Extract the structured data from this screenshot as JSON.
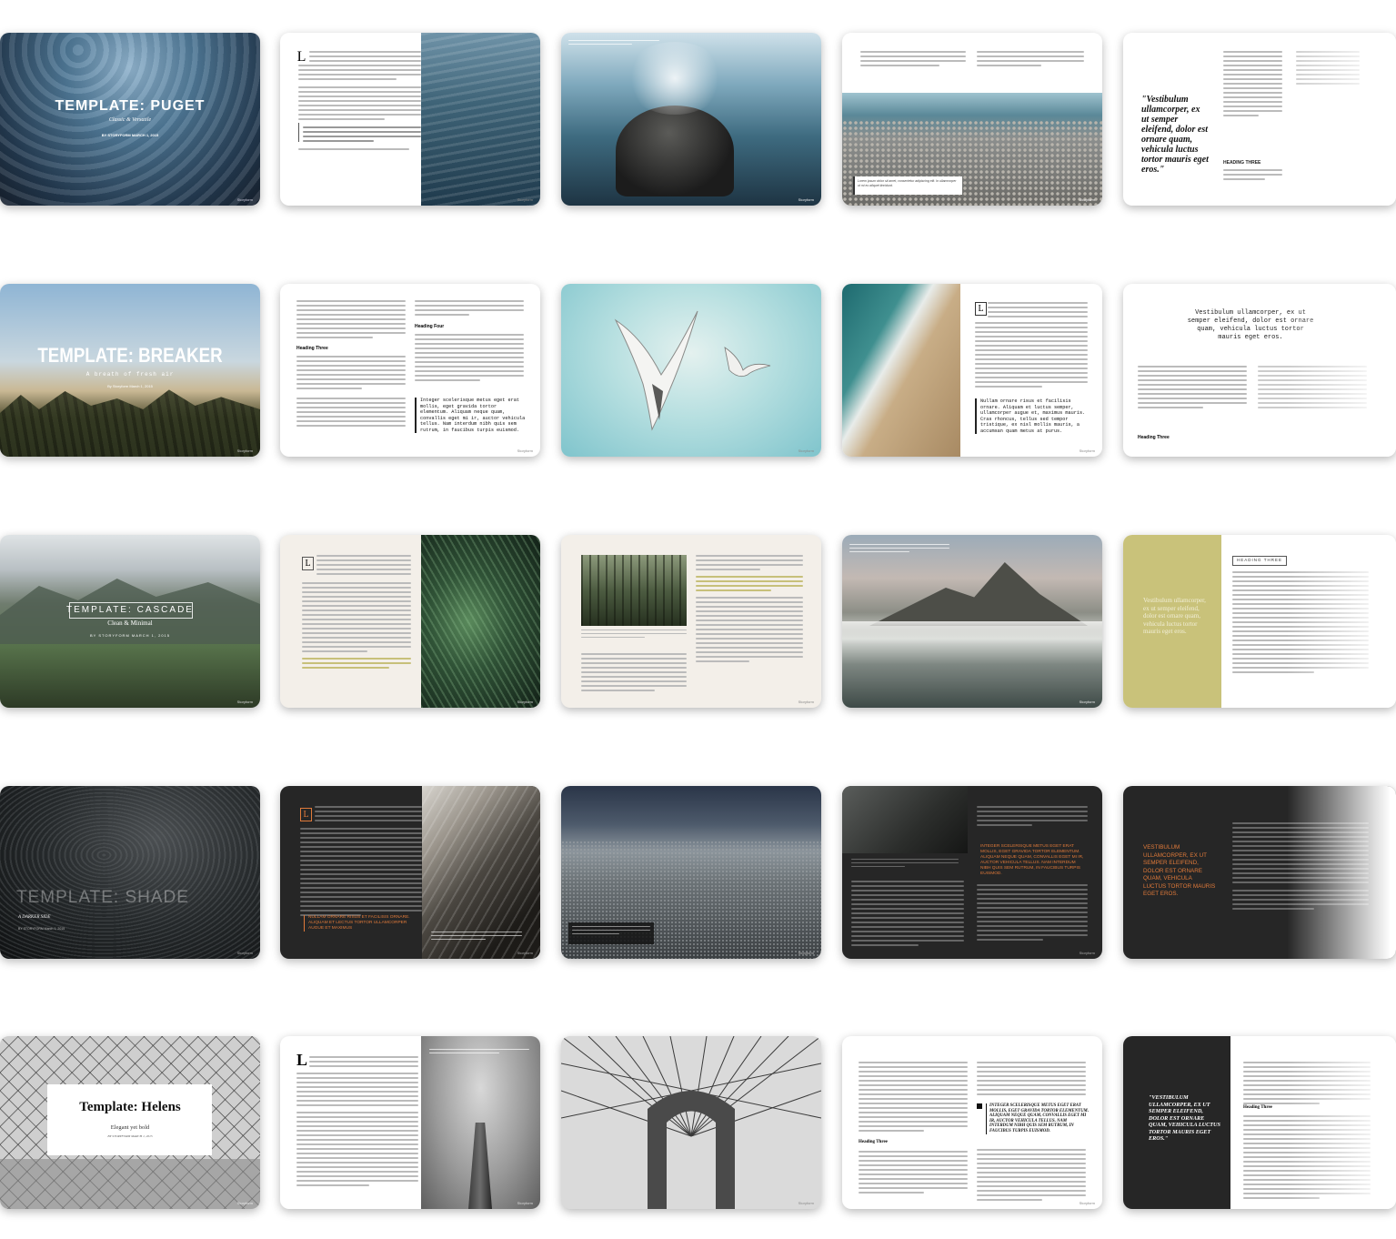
{
  "templates": {
    "puget": {
      "title": "TEMPLATE: PUGET",
      "subtitle": "Classic & Versatile",
      "byline": "BY STORYFORM   MARCH 1, 2015",
      "quote": "\"Vestibulum ullamcorper, ex ut semper eleifend, dolor est ornare quam, vehicula luctus tortor mauris eget eros.\"",
      "heading_three": "HEADING THREE"
    },
    "breaker": {
      "title": "TEMPLATE: BREAKER",
      "subtitle": "A breath of fresh air",
      "byline": "By Storyform   March 1, 2015",
      "heading_three": "Heading Three",
      "heading_four": "Heading Four",
      "code_quote": "Integer scelerisque metus eget erat mollis, eget gravida tortor elementum. Aliquam neque quam, convallis eget mi ir, auctor vehicula tellus. Nam interdum nibh quis sem rutrum, in faucibus turpis euismod.",
      "code_quote_2": "Nullam ornare risus et facilisis ornare. Aliquam et luctus semper, ullamcorper augue et, maximus mauris. Cras rhoncus, tellus sed tempor tristique, ex nisl mollis mauris, a accumsan quam metus at purus.",
      "pull_quote": "Vestibulum ullamcorper, ex ut semper eleifend, dolor est ornare quam, vehicula luctus tortor mauris eget eros."
    },
    "cascade": {
      "title": "TEMPLATE: CASCADE",
      "subtitle": "Clean & Minimal",
      "byline": "BY STORYFORM   MARCH 1, 2015",
      "pull_quote": "Vestibulum ullamcorper, ex ut semper eleifend, dolor est ornare quam, vehicula luctus tortor mauris eget eros.",
      "heading_three": "HEADING THREE"
    },
    "shade": {
      "title": "TEMPLATE: SHADE",
      "subtitle": "A DARKER SIDE",
      "byline": "BY STORYFORM     March 1, 2015",
      "orange_quote": "NULLAM ORNARE RISUS ET FACILISIS ORNARE. ALIQUAM ET LECTUS TORTOR ULLAMCORPER AUGUE ET MAXIMUS",
      "orange_quote_2": "INTEGER SCELERISQUE METUS EGET ERAT MOLLIS, EGET GRAVIDA TORTOR ELEMENTUM. ALIQUAM NEQUE QUAM, CONVALLIS EGET MI IR, AUCTOR VEHICULA TELLUS. NAM INTERDUM NIBH QUIS SEM RUTRUM, IN FAUCIBUS TURPIS EUISMOD.",
      "big_quote": "VESTIBULUM ULLAMCORPER, EX UT SEMPER ELEIFEND, DOLOR EST ORNARE QUAM, VEHICULA LUCTUS TORTOR MAURIS EGET EROS."
    },
    "helens": {
      "title": "Template: Helens",
      "subtitle": "Elegant yet bold",
      "byline": "BY STORYFORM     MARCH 1, 2015",
      "heading_three": "Heading Three",
      "bold_quote": "INTEGER SCELERISQUE METUS EGET ERAT MOLLIS, EGET GRAVIDA TORTOR ELEMENTUM. ALIQUAM NEQUE QUAM, CONVALLIS EGET MI IR, AUCTOR VEHICULA TELLUS. NAM INTERDUM NIBH QUIS SEM RUTRUM, IN FAUCIBUS TURPIS EUISMOD.",
      "dark_quote": "\"VESTIBULUM ULLAMCORPER, EX UT SEMPER ELEIFEND, DOLOR EST ORNARE QUAM, VEHICULA LUCTUS TORTOR MAURIS EGET EROS.\""
    }
  },
  "caption_text": "Lorem ipsum dolor sit amet, consectetur adipiscing elit. In ullamcorper ut mi eu aliquet tincidunt.",
  "footer_label": "Storyform"
}
